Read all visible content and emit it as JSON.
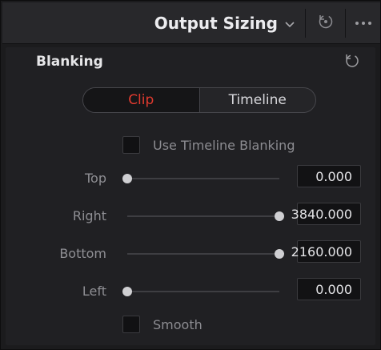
{
  "header": {
    "title": "Output Sizing",
    "dropdown_icon": "chevron-down-icon",
    "reset_icon": "reset-icon",
    "more_icon": "more-options-icon"
  },
  "section": {
    "title": "Blanking",
    "reset_icon": "reset-icon"
  },
  "tabs": [
    {
      "label": "Clip",
      "active": true
    },
    {
      "label": "Timeline",
      "active": false
    }
  ],
  "use_timeline_blanking": {
    "label": "Use Timeline Blanking",
    "checked": false
  },
  "params": [
    {
      "label": "Top",
      "value": "0.000",
      "slider_fraction": 0.0
    },
    {
      "label": "Right",
      "value": "3840.000",
      "slider_fraction": 1.0
    },
    {
      "label": "Bottom",
      "value": "2160.000",
      "slider_fraction": 1.0
    },
    {
      "label": "Left",
      "value": "0.000",
      "slider_fraction": 0.0
    }
  ],
  "smooth": {
    "label": "Smooth",
    "checked": false
  },
  "colors": {
    "accent": "#e03a2f",
    "panel": "#202023",
    "header": "#28282b"
  }
}
